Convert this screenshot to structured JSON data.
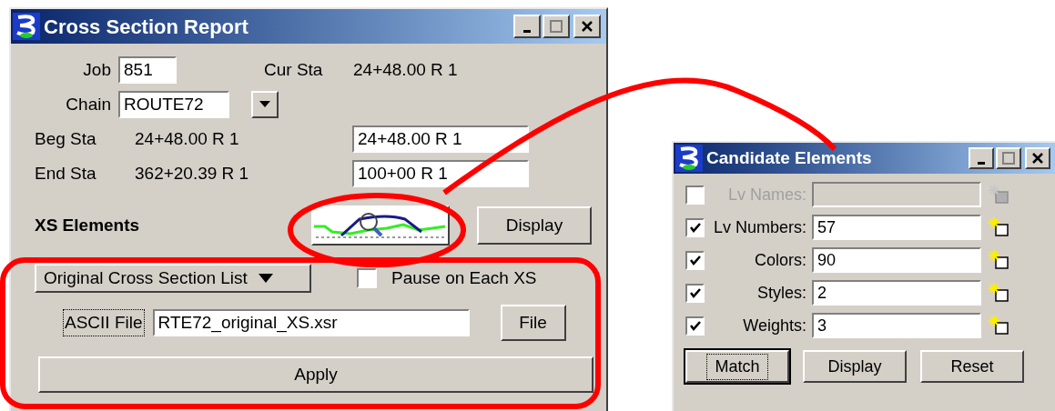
{
  "report_window": {
    "title": "Cross Section Report",
    "job": {
      "label": "Job",
      "value": "851"
    },
    "cur_sta": {
      "label": "Cur Sta",
      "value": "24+48.00 R 1"
    },
    "chain": {
      "label": "Chain",
      "value": "ROUTE72"
    },
    "beg_sta": {
      "label": "Beg Sta",
      "value": "24+48.00 R 1",
      "input": "24+48.00 R 1"
    },
    "end_sta": {
      "label": "End Sta",
      "value": "362+20.39 R 1",
      "input": "100+00 R 1"
    },
    "xs_elements": {
      "label": "XS Elements",
      "display_button": "Display"
    },
    "list_dropdown": "Original Cross Section List",
    "pause": {
      "label": "Pause on Each XS",
      "checked": false
    },
    "ascii_file": {
      "label": "ASCII File",
      "focused": true,
      "value": "RTE72_original_XS.xsr",
      "button": "File"
    },
    "apply_button": "Apply"
  },
  "candidate_window": {
    "title": "Candidate Elements",
    "rows": [
      {
        "label": "Lv Names:",
        "checked": false,
        "disabled": true
      },
      {
        "label": "Lv Numbers:",
        "checked": true,
        "disabled": false,
        "value": "57"
      },
      {
        "label": "Colors:",
        "checked": true,
        "disabled": false,
        "value": "90"
      },
      {
        "label": "Styles:",
        "checked": true,
        "disabled": false,
        "value": "2"
      },
      {
        "label": "Weights:",
        "checked": true,
        "disabled": false,
        "value": "3"
      }
    ],
    "buttons": [
      {
        "label": "Match",
        "focused": true
      },
      {
        "label": "Display",
        "focused": false
      },
      {
        "label": "Reset",
        "focused": false
      }
    ]
  }
}
